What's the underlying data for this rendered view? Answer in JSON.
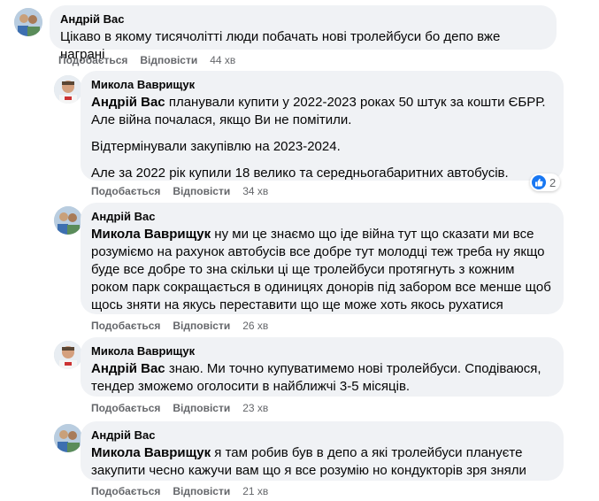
{
  "actions": {
    "like": "Подобається",
    "reply": "Відповісти"
  },
  "comments": [
    {
      "author": "Андрій Вас",
      "paragraphs": [
        {
          "mention": "",
          "text": "Цікаво в якому тисячолітті люди побачать нові тролейбуси бо депо вже награні"
        }
      ],
      "time": "44 хв"
    },
    {
      "author": "Микола Ваврищук",
      "paragraphs": [
        {
          "mention": "Андрій Вас",
          "text": " планували купити у 2022-2023 роках 50 штук за кошти ЄБРР. Але війна почалася, якщо Ви не помітили."
        },
        {
          "mention": "",
          "text": "Відтермінували закупівлю на 2023-2024."
        },
        {
          "mention": "",
          "text": "Але за 2022 рік купили 18 велико та середньогабаритних автобусів."
        }
      ],
      "time": "34 хв",
      "reaction_count": "2",
      "reaction_icon": "like-icon"
    },
    {
      "author": "Андрій Вас",
      "paragraphs": [
        {
          "mention": "Микола Ваврищук",
          "text": " ну ми це знаємо що іде війна тут що сказати ми все розуміємо на рахунок автобусів все добре тут молодці теж треба ну якщо буде все добре то зна скільки ці ще тролейбуси протягнуть з кожним роком парк сокращається в одиницях донорів під забором все менше щоб щось зняти на якусь переставити що ще може хоть якось рухатися"
        }
      ],
      "time": "26 хв"
    },
    {
      "author": "Микола Ваврищук",
      "paragraphs": [
        {
          "mention": "Андрій Вас",
          "text": " знаю. Ми точно купуватимемо нові тролейбуси. Сподіваюся, тендер зможемо оголосити в найближчі 3-5 місяців."
        }
      ],
      "time": "23 хв"
    },
    {
      "author": "Андрій Вас",
      "paragraphs": [
        {
          "mention": "Микола Ваврищук",
          "text": " я там робив був в депо а які тролейбуси плануєте закупити чесно кажучи вам що я все розумію но кондукторів зря зняли"
        }
      ],
      "time": "21 хв"
    }
  ],
  "colors": {
    "bubble": "#f0f2f5",
    "meta": "#65676b",
    "like": "#1877f2"
  }
}
